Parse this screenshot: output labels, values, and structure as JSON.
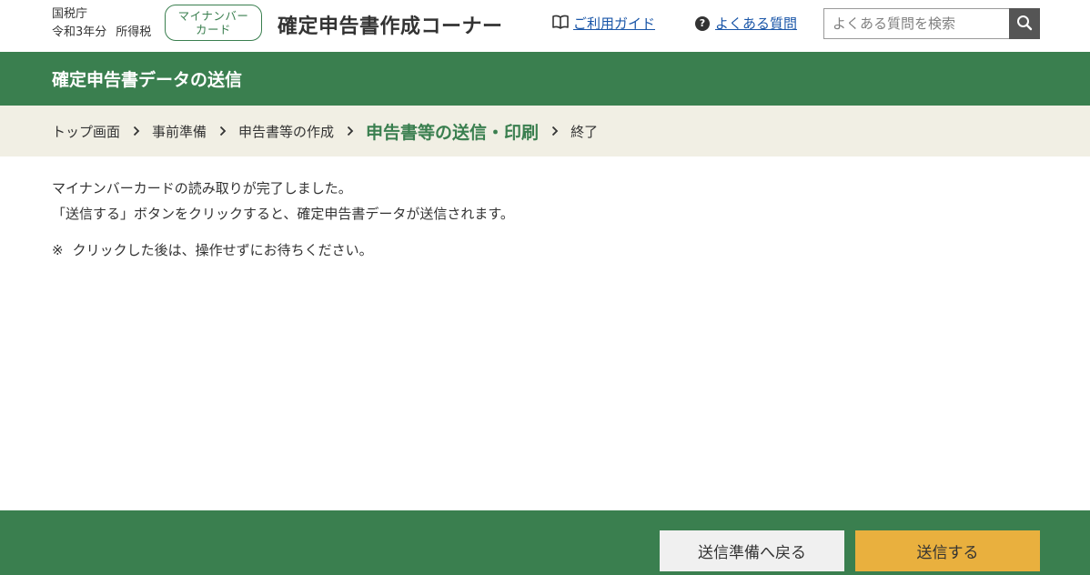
{
  "header": {
    "agency": "国税庁",
    "year": "令和3年分",
    "tax_type": "所得税",
    "mynumber_badge": [
      "マイナンバー",
      "カード"
    ],
    "site_title": "確定申告書作成コーナー",
    "guide_link": "ご利用ガイド",
    "faq_link": "よくある質問",
    "search": {
      "placeholder": "よくある質問を検索",
      "value": ""
    },
    "icons": {
      "guide": "book-icon",
      "faq": "question-circle-icon",
      "search": "search-icon"
    }
  },
  "page_title": "確定申告書データの送信",
  "steps": [
    {
      "label": "トップ画面"
    },
    {
      "label": "事前準備"
    },
    {
      "label": "申告書等の作成"
    },
    {
      "label": "申告書等の送信・印刷"
    },
    {
      "label": "終了"
    }
  ],
  "content": {
    "line1": "マイナンバーカードの読み取りが完了しました。",
    "line2": "「送信する」ボタンをクリックすると、確定申告書データが送信されます。",
    "note_mark": "※",
    "note_text": "クリックした後は、操作せずにお待ちください。"
  },
  "footer": {
    "back_label": "送信準備へ戻る",
    "send_label": "送信する"
  },
  "colors": {
    "brand_green": "#3a7f4f",
    "steps_bg": "#f1efe4",
    "send_button": "#e9b03e",
    "link": "#1a56a8"
  }
}
